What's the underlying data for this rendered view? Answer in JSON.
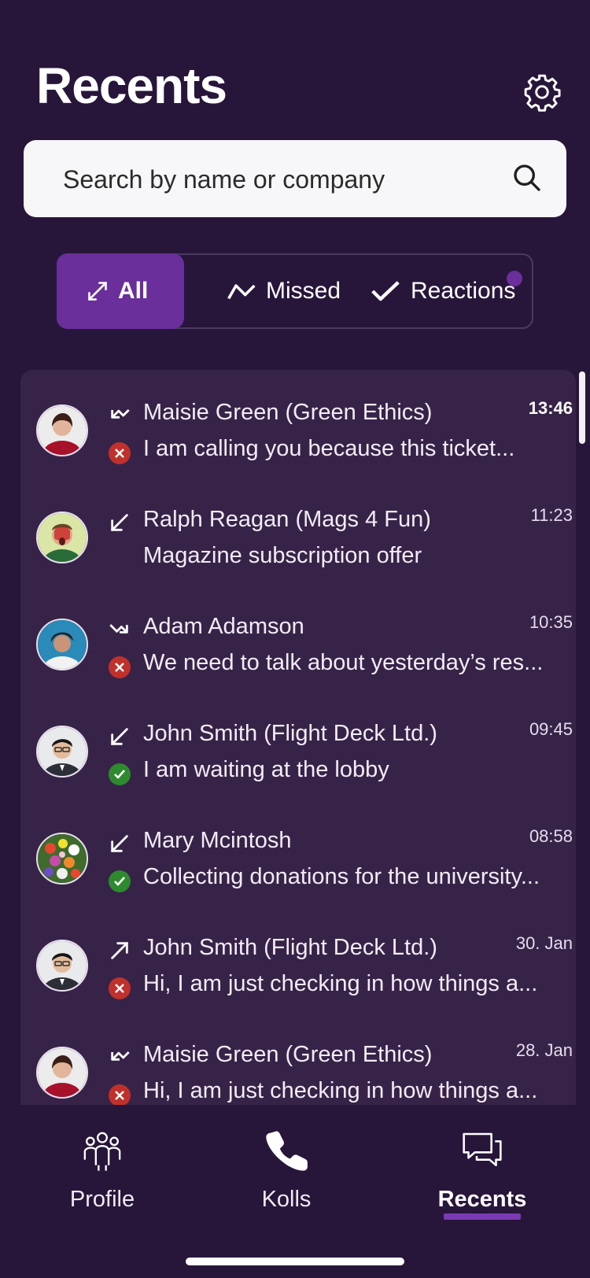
{
  "header": {
    "title": "Recents"
  },
  "search": {
    "placeholder": "Search by name or company"
  },
  "filters": [
    {
      "label": "All",
      "active": true
    },
    {
      "label": "Missed",
      "active": false
    },
    {
      "label": "Reactions",
      "active": false,
      "has_indicator": true
    }
  ],
  "calls": [
    {
      "name": "Maisie Green (Green Ethics)",
      "message": "I am calling you because this ticket...",
      "time": "13:46",
      "time_bold": true,
      "direction": "missed-incoming-icon",
      "status": "missed"
    },
    {
      "name": "Ralph Reagan (Mags 4 Fun)",
      "message": "Magazine subscription offer",
      "time": "11:23",
      "time_bold": false,
      "direction": "incoming-icon",
      "status": "none"
    },
    {
      "name": "Adam Adamson",
      "message": "We need to talk about yesterday’s res...",
      "time": "10:35",
      "time_bold": false,
      "direction": "missed-outgoing-icon",
      "status": "missed"
    },
    {
      "name": "John Smith (Flight Deck Ltd.)",
      "message": "I am waiting at the lobby",
      "time": "09:45",
      "time_bold": false,
      "direction": "incoming-icon",
      "status": "ok"
    },
    {
      "name": "Mary Mcintosh",
      "message": "Collecting donations for the university...",
      "time": "08:58",
      "time_bold": false,
      "direction": "incoming-icon",
      "status": "ok"
    },
    {
      "name": "John Smith (Flight Deck Ltd.)",
      "message": "Hi, I am just checking in how things a...",
      "time": "30. Jan",
      "time_bold": false,
      "direction": "outgoing-icon",
      "status": "missed"
    },
    {
      "name": "Maisie Green (Green Ethics)",
      "message": "Hi, I am just checking in how things a...",
      "time": "28. Jan",
      "time_bold": false,
      "direction": "missed-incoming-icon",
      "status": "missed"
    }
  ],
  "nav": [
    {
      "label": "Profile",
      "icon": "people-icon",
      "active": false
    },
    {
      "label": "Kolls",
      "icon": "phone-icon",
      "active": false
    },
    {
      "label": "Recents",
      "icon": "chat-bubbles-icon",
      "active": true
    }
  ],
  "colors": {
    "background": "#27163a",
    "list_bg": "#382348",
    "accent": "#6a2f9b",
    "missed": "#c0312b",
    "ok": "#2e8a2e"
  }
}
